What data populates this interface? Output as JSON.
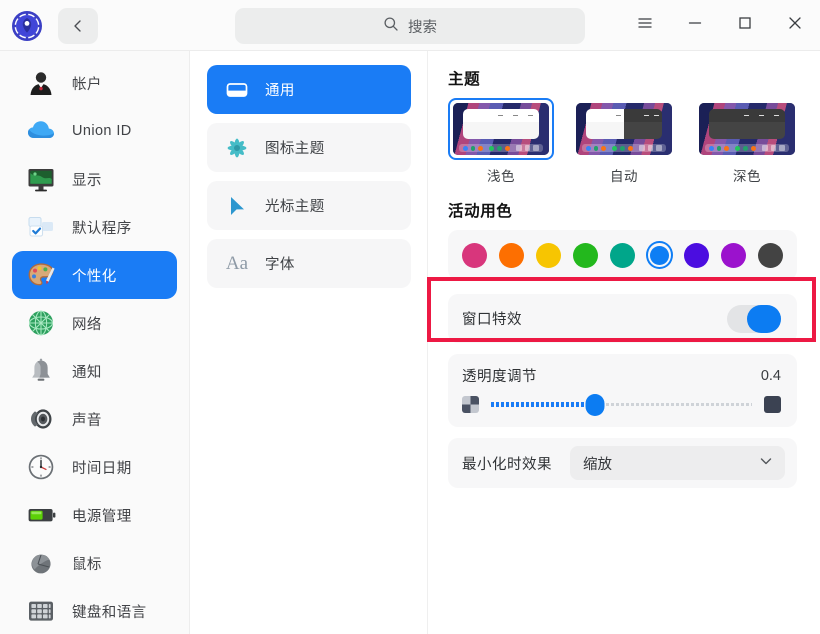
{
  "titlebar": {
    "logo_icon": "control-center-logo",
    "back_icon": "chevron-left-icon",
    "search": {
      "icon": "search-icon",
      "placeholder": "搜索",
      "value": ""
    },
    "menu_icon": "hamburger-menu-icon",
    "minimize_icon": "minimize-icon",
    "maximize_icon": "maximize-icon",
    "close_icon": "close-icon"
  },
  "sidebar": {
    "items": [
      {
        "label": "帐户",
        "icon": "account-icon",
        "selected": false
      },
      {
        "label": "Union ID",
        "icon": "cloud-icon",
        "selected": false
      },
      {
        "label": "显示",
        "icon": "display-monitor-icon",
        "selected": false
      },
      {
        "label": "默认程序",
        "icon": "default-apps-icon",
        "selected": false
      },
      {
        "label": "个性化",
        "icon": "palette-icon",
        "selected": true
      },
      {
        "label": "网络",
        "icon": "globe-network-icon",
        "selected": false
      },
      {
        "label": "通知",
        "icon": "bell-icon",
        "selected": false
      },
      {
        "label": "声音",
        "icon": "speaker-icon",
        "selected": false
      },
      {
        "label": "时间日期",
        "icon": "clock-icon",
        "selected": false
      },
      {
        "label": "电源管理",
        "icon": "battery-icon",
        "selected": false
      },
      {
        "label": "鼠标",
        "icon": "mouse-icon",
        "selected": false
      },
      {
        "label": "键盘和语言",
        "icon": "keyboard-icon",
        "selected": false
      }
    ]
  },
  "subnav": {
    "items": [
      {
        "label": "通用",
        "icon": "general-window-icon",
        "selected": true
      },
      {
        "label": "图标主题",
        "icon": "icon-theme-flower-icon",
        "selected": false
      },
      {
        "label": "光标主题",
        "icon": "cursor-arrow-icon",
        "selected": false
      },
      {
        "label": "字体",
        "icon": "font-Aa-icon",
        "selected": false
      }
    ]
  },
  "main": {
    "theme_section": {
      "title": "主题",
      "options": [
        {
          "label": "浅色",
          "mode": "light",
          "selected": true
        },
        {
          "label": "自动",
          "mode": "auto",
          "selected": false
        },
        {
          "label": "深色",
          "mode": "dark",
          "selected": false
        }
      ]
    },
    "accent_section": {
      "title": "活动用色",
      "colors": [
        {
          "name": "magenta",
          "hex": "#d8367c",
          "selected": false
        },
        {
          "name": "orange",
          "hex": "#fd6f01",
          "selected": false
        },
        {
          "name": "yellow",
          "hex": "#f7c501",
          "selected": false
        },
        {
          "name": "green",
          "hex": "#23b81d",
          "selected": false
        },
        {
          "name": "teal",
          "hex": "#00a68a",
          "selected": false
        },
        {
          "name": "blue",
          "hex": "#0e7ef4",
          "selected": true
        },
        {
          "name": "indigo",
          "hex": "#4b0de0",
          "selected": false
        },
        {
          "name": "purple",
          "hex": "#9b12cd",
          "selected": false
        },
        {
          "name": "gray",
          "hex": "#434343",
          "selected": false
        }
      ]
    },
    "window_effects": {
      "label": "窗口特效",
      "toggle_on": true,
      "highlight_color": "#ed1944"
    },
    "transparency": {
      "label": "透明度调节",
      "value": "0.4",
      "min_icon": "transparent-checkerboard-icon",
      "max_icon": "opaque-square-icon",
      "fill_percent": 40
    },
    "minimize_effect": {
      "label": "最小化时效果",
      "value": "缩放",
      "chevron_icon": "chevron-down-icon"
    }
  }
}
